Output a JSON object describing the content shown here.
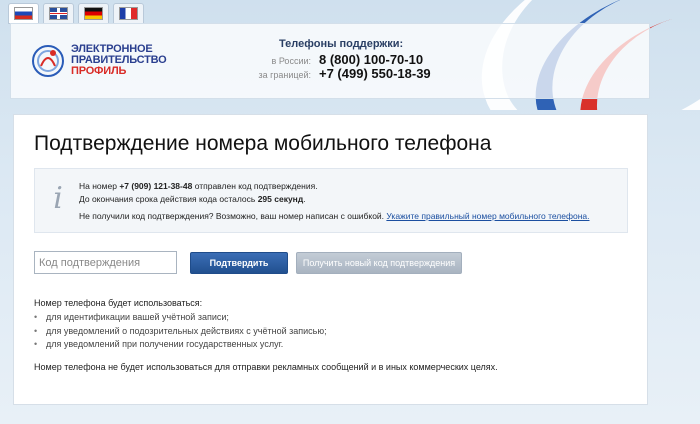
{
  "languages": [
    {
      "code": "ru",
      "active": true
    },
    {
      "code": "en",
      "active": false
    },
    {
      "code": "de",
      "active": false
    },
    {
      "code": "fr",
      "active": false
    }
  ],
  "header": {
    "logo_line1": "ЭЛЕКТРОННОЕ",
    "logo_line2": "ПРАВИТЕЛЬСТВО",
    "logo_line3": "ПРОФИЛЬ",
    "support_title": "Телефоны поддержки:",
    "support_russia_label": "в России:",
    "support_russia_number": "8 (800) 100-70-10",
    "support_abroad_label": "за границей:",
    "support_abroad_number": "+7 (499) 550-18-39"
  },
  "page": {
    "title": "Подтверждение номера мобильного телефона"
  },
  "info": {
    "line1_prefix": "На номер ",
    "phone": "+7 (909) 121-38-48",
    "line1_suffix": " отправлен код подтверждения.",
    "line2_prefix": "До окончания срока действия кода осталось ",
    "seconds": "295 секунд",
    "line2_suffix": ".",
    "line3_text": "Не получили код подтверждения? Возможно, ваш номер написан с ошибкой. ",
    "line3_link": "Укажите правильный номер мобильного телефона."
  },
  "form": {
    "code_placeholder": "Код подтверждения",
    "code_value": "",
    "confirm_label": "Подтвердить",
    "new_code_label": "Получить новый код подтверждения"
  },
  "usage": {
    "title": "Номер телефона будет использоваться:",
    "items": [
      "для идентификации вашей учётной записи;",
      "для уведомлений о подозрительных действиях с учётной записью;",
      "для уведомлений при получении государственных услуг."
    ],
    "no_ads": "Номер телефона не будет использоваться для отправки рекламных сообщений и в иных коммерческих целях."
  },
  "colors": {
    "brand_blue": "#2a3f8f",
    "brand_red": "#d92c27",
    "button_primary": "#2b5ea3",
    "button_disabled": "#b3bdc9",
    "link": "#1b4fa0"
  }
}
